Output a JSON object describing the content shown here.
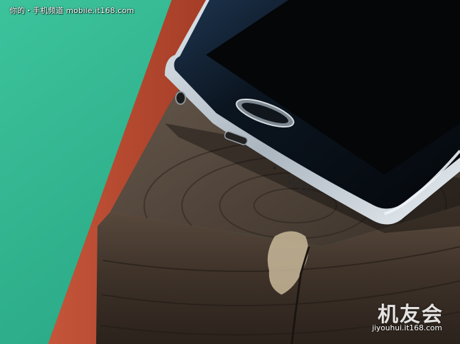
{
  "watermark_top": "你的・手机频道 mobile.it168.com",
  "watermark_logo": "机友会",
  "watermark_url": "jiyouhui.it168.com",
  "colors": {
    "background_green": "#2fb38f",
    "track_red": "#b8472c",
    "wood_dark": "#3a2f27",
    "wood_light": "#6e5e4f",
    "phone_glass": "#0e1620",
    "phone_frame": "#b9c3cb"
  }
}
